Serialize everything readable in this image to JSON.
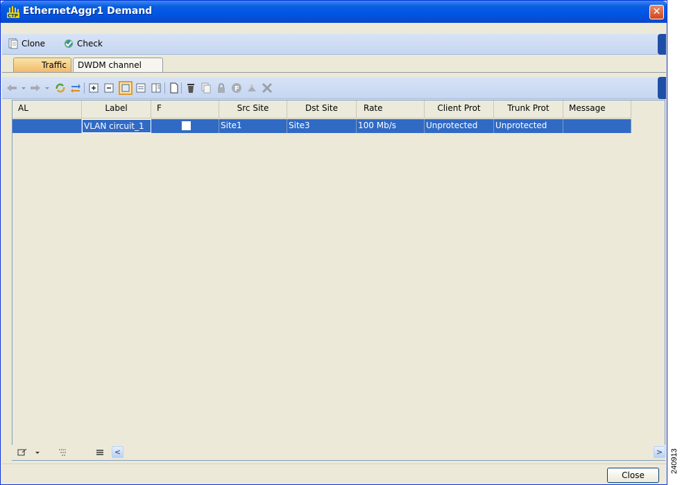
{
  "window": {
    "title": "EthernetAggr1 Demand",
    "close_glyph": "✕"
  },
  "menubar": {
    "clone_label": "Clone",
    "check_label": "Check"
  },
  "tabs": [
    {
      "label": "Traffic",
      "active": true
    },
    {
      "label": "DWDM channel",
      "active": false
    }
  ],
  "toolbar": {
    "icons": [
      "back-arrow-icon",
      "dropdown-icon",
      "forward-arrow-icon",
      "dropdown-icon",
      "refresh-icon",
      "swap-icon",
      "expand-all-icon",
      "collapse-all-icon",
      "view-grid-icon",
      "view-rows-icon",
      "view-columns-icon",
      "new-document-icon",
      "delete-icon",
      "copy-icon",
      "lock-icon",
      "f-badge-icon",
      "up-level-icon",
      "tools-icon"
    ]
  },
  "grid": {
    "columns": [
      "AL",
      "Label",
      "F",
      "Src Site",
      "Dst Site",
      "Rate",
      "Client Prot",
      "Trunk Prot",
      "Message"
    ],
    "rows": [
      {
        "al": "",
        "label": "VLAN circuit_1",
        "f": false,
        "src_site": "Site1",
        "dst_site": "Site3",
        "rate": "100 Mb/s",
        "client_prot": "Unprotected",
        "trunk_prot": "Unprotected",
        "message": ""
      }
    ]
  },
  "scroll": {
    "left_arrow": "<",
    "right_arrow": ">"
  },
  "footer": {
    "close_label": "Close"
  },
  "figure_number": "240913",
  "colors": {
    "titlebar": "#0055e5",
    "selection": "#316ac5",
    "active_tab": "#f0b86b",
    "toolbar": "#c5d6f1"
  }
}
